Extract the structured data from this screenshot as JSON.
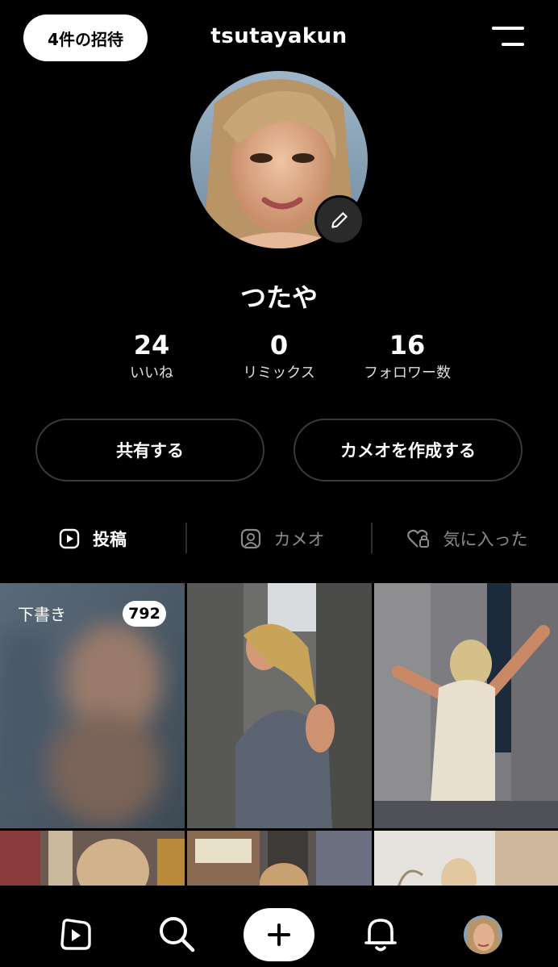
{
  "header": {
    "invite_label": "4件の招待",
    "username": "tsutayakun"
  },
  "profile": {
    "display_name": "つたや",
    "stats": [
      {
        "value": "24",
        "label": "いいね"
      },
      {
        "value": "0",
        "label": "リミックス"
      },
      {
        "value": "16",
        "label": "フォロワー数"
      }
    ]
  },
  "actions": {
    "share_label": "共有する",
    "create_cameo_label": "カメオを作成する"
  },
  "tabs": [
    {
      "label": "投稿",
      "icon": "play-square-icon",
      "active": true
    },
    {
      "label": "カメオ",
      "icon": "person-square-icon",
      "active": false
    },
    {
      "label": "気に入った",
      "icon": "heart-lock-icon",
      "active": false
    }
  ],
  "grid": {
    "draft_label": "下書き",
    "draft_count": "792"
  },
  "bottom_nav": [
    {
      "name": "feed",
      "icon": "play-icon"
    },
    {
      "name": "search",
      "icon": "search-icon"
    },
    {
      "name": "create",
      "icon": "plus-icon"
    },
    {
      "name": "notifications",
      "icon": "bell-icon"
    },
    {
      "name": "profile",
      "icon": "avatar"
    }
  ],
  "colors": {
    "background": "#000000",
    "button_border": "#3a3a3a",
    "inactive_text": "#8a8a8a"
  }
}
